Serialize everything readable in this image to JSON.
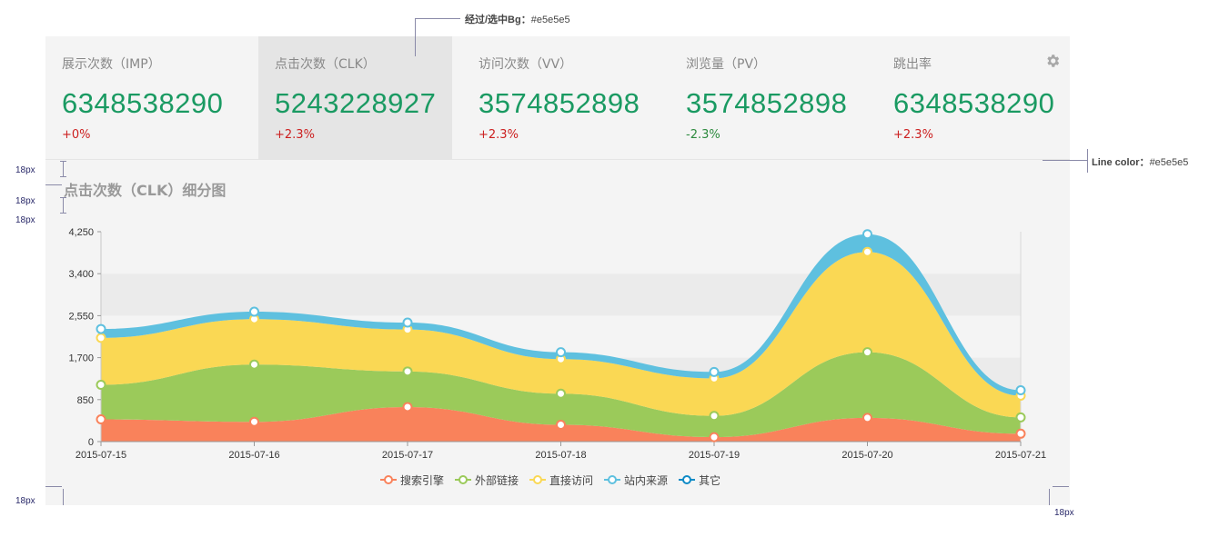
{
  "metrics": [
    {
      "label": "展示次数（IMP）",
      "value": "6348538290",
      "delta": "+0%",
      "trend": "pos"
    },
    {
      "label": "点击次数（CLK）",
      "value": "5243228927",
      "delta": "+2.3%",
      "trend": "pos",
      "selected": true
    },
    {
      "label": "访问次数（VV）",
      "value": "3574852898",
      "delta": "+2.3%",
      "trend": "pos"
    },
    {
      "label": "浏览量（PV）",
      "value": "3574852898",
      "delta": "-2.3%",
      "trend": "neg"
    },
    {
      "label": "跳出率",
      "value": "6348538290",
      "delta": "+2.3%",
      "trend": "pos"
    }
  ],
  "chart_title": "点击次数（CLK）细分图",
  "annotations": {
    "hover_bg_label": "经过/选中Bg：",
    "hover_bg_value": "#e5e5e5",
    "line_color_label": "Line color：",
    "line_color_value": "#e5e5e5",
    "spacing_labels": [
      "18px",
      "18px",
      "18px",
      "18px",
      "18px"
    ]
  },
  "colors": {
    "selected_bg": "#e5e5e5",
    "line": "#e5e5e5",
    "value_green": "#1a9a62",
    "delta_up": "#cc1f1f",
    "delta_down": "#2d8a3e"
  },
  "icons": {
    "settings": "gear-icon"
  },
  "chart_data": {
    "type": "area",
    "stacked": true,
    "categories": [
      "2015-07-15",
      "2015-07-16",
      "2015-07-17",
      "2015-07-18",
      "2015-07-19",
      "2015-07-20",
      "2015-07-21"
    ],
    "yticks": [
      "0",
      "850",
      "1,700",
      "2,550",
      "3,400",
      "4,250"
    ],
    "ylim": [
      0,
      4250
    ],
    "grid": "horizontal bands",
    "legend_position": "bottom",
    "series": [
      {
        "name": "搜索引擎",
        "color": "#f9825b",
        "values": [
          450,
          400,
          700,
          340,
          90,
          480,
          160
        ]
      },
      {
        "name": "外部链接",
        "color": "#9bca5a",
        "values": [
          700,
          1160,
          720,
          630,
          430,
          1330,
          330
        ]
      },
      {
        "name": "直接访问",
        "color": "#fad854",
        "values": [
          950,
          920,
          850,
          700,
          760,
          2030,
          440
        ]
      },
      {
        "name": "站内来源",
        "color": "#5ec0df",
        "values": [
          180,
          150,
          140,
          140,
          130,
          360,
          110
        ]
      },
      {
        "name": "其它",
        "color": "#0e8ac6",
        "values": [
          0,
          0,
          0,
          0,
          0,
          0,
          0
        ]
      }
    ]
  }
}
